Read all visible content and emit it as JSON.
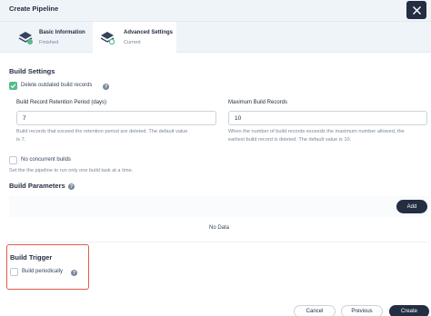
{
  "header": {
    "title": "Create Pipeline"
  },
  "steps": [
    {
      "label": "Basic Information",
      "status": "Finished"
    },
    {
      "label": "Advanced Settings",
      "status": "Current"
    }
  ],
  "build_settings": {
    "title": "Build Settings",
    "delete_outdated": {
      "label": "Delete outdated build records",
      "checked": true
    },
    "retention": {
      "label": "Build Record Retention Period (days)",
      "value": "7",
      "desc_line1": "Build records that exceed the retention period are deleted. The default value",
      "desc_line2": "is 7."
    },
    "max_records": {
      "label": "Maximum Build Records",
      "value": "10",
      "desc_line1": "When the number of build records exceeds the maximum number allowed, the",
      "desc_line2": "earliest build record is deleted. The default value is 10."
    },
    "no_concurrent": {
      "label": "No concurrent builds",
      "checked": false,
      "desc": "Set the the pipeline to run only one build task at a time."
    }
  },
  "build_parameters": {
    "title": "Build Parameters",
    "add_label": "Add",
    "empty_text": "No Data"
  },
  "build_trigger": {
    "title": "Build Trigger",
    "periodic": {
      "label": "Build periodically",
      "checked": false
    }
  },
  "footer": {
    "cancel_label": "Cancel",
    "previous_label": "Previous",
    "create_label": "Create"
  },
  "help_glyph": "?",
  "colors": {
    "accent_dark": "#242e42",
    "check_green": "#55bc8a",
    "highlight_red": "#e25a4c",
    "header_bg": "#eff4f9"
  }
}
